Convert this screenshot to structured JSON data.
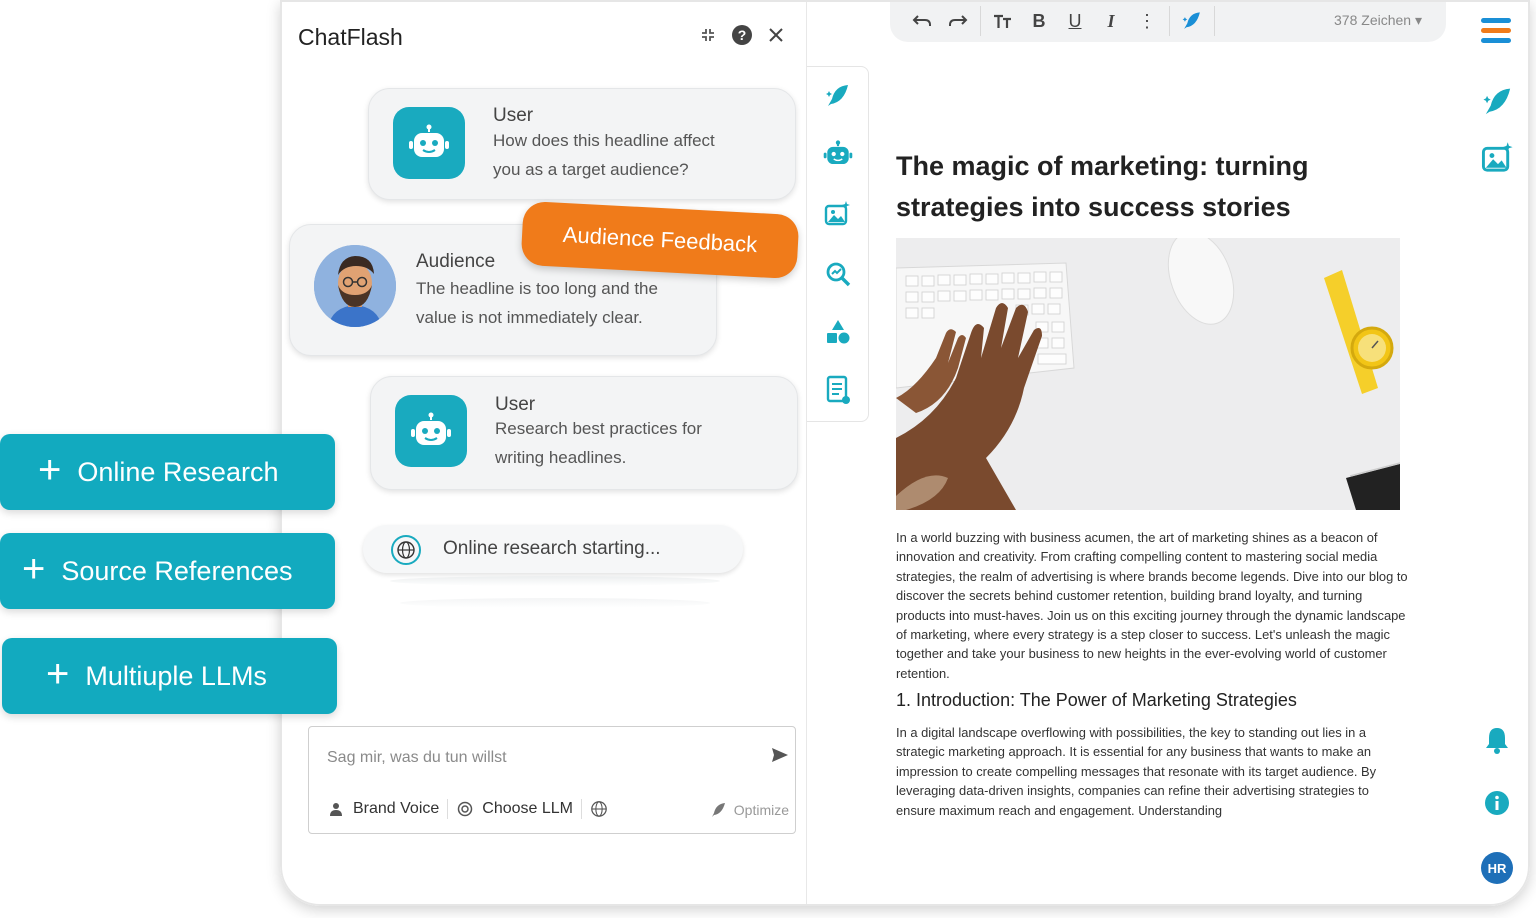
{
  "chat": {
    "title": "ChatFlash",
    "messages": [
      {
        "name": "User",
        "text_line1": "How does this headline affect",
        "text_line2": "you as a target audience?"
      },
      {
        "name": "Audience",
        "text_line1": "The headline is too long and the",
        "text_line2": "value is not immediately clear."
      },
      {
        "name": "User",
        "text_line1": "Research best practices for",
        "text_line2": "writing headlines."
      }
    ],
    "feedback_tag": "Audience Feedback",
    "research_status": "Online research starting...",
    "input": {
      "placeholder": "Sag mir, was du tun willst",
      "brand_voice": "Brand Voice",
      "choose_llm": "Choose LLM",
      "optimize": "Optimize"
    }
  },
  "editor": {
    "char_count": "378 Zeichen",
    "title": "The magic of marketing: turning strategies into success stories",
    "intro": "In a world buzzing with business acumen, the art of marketing shines as a beacon of innovation and creativity. From crafting compelling content to mastering social media strategies, the realm of advertising is where brands become legends. Dive into our blog to discover the secrets behind customer retention, building brand loyalty, and turning products into must-haves. Join us on this exciting journey through the dynamic landscape of marketing, where every strategy is a step closer to success. Let's unleash the magic together and take your business to new heights in the ever-evolving world of customer retention.",
    "section_heading": "1. Introduction: The Power of Marketing Strategies",
    "section_text": "In a digital landscape overflowing with possibilities, the key to standing out lies in a strategic marketing approach. It is essential for any business that wants to make an impression to create compelling messages that resonate with its target audience. By leveraging data-driven insights, companies can refine their advertising strategies to ensure maximum reach and engagement. Understanding"
  },
  "user_avatar": "HR",
  "features": [
    {
      "label": "Online Research"
    },
    {
      "label": "Source References"
    },
    {
      "label": "Multiuple LLMs"
    }
  ],
  "colors": {
    "accent": "#12aabf",
    "orange": "#f07b1a",
    "brand_blue": "#1e6fb8"
  }
}
